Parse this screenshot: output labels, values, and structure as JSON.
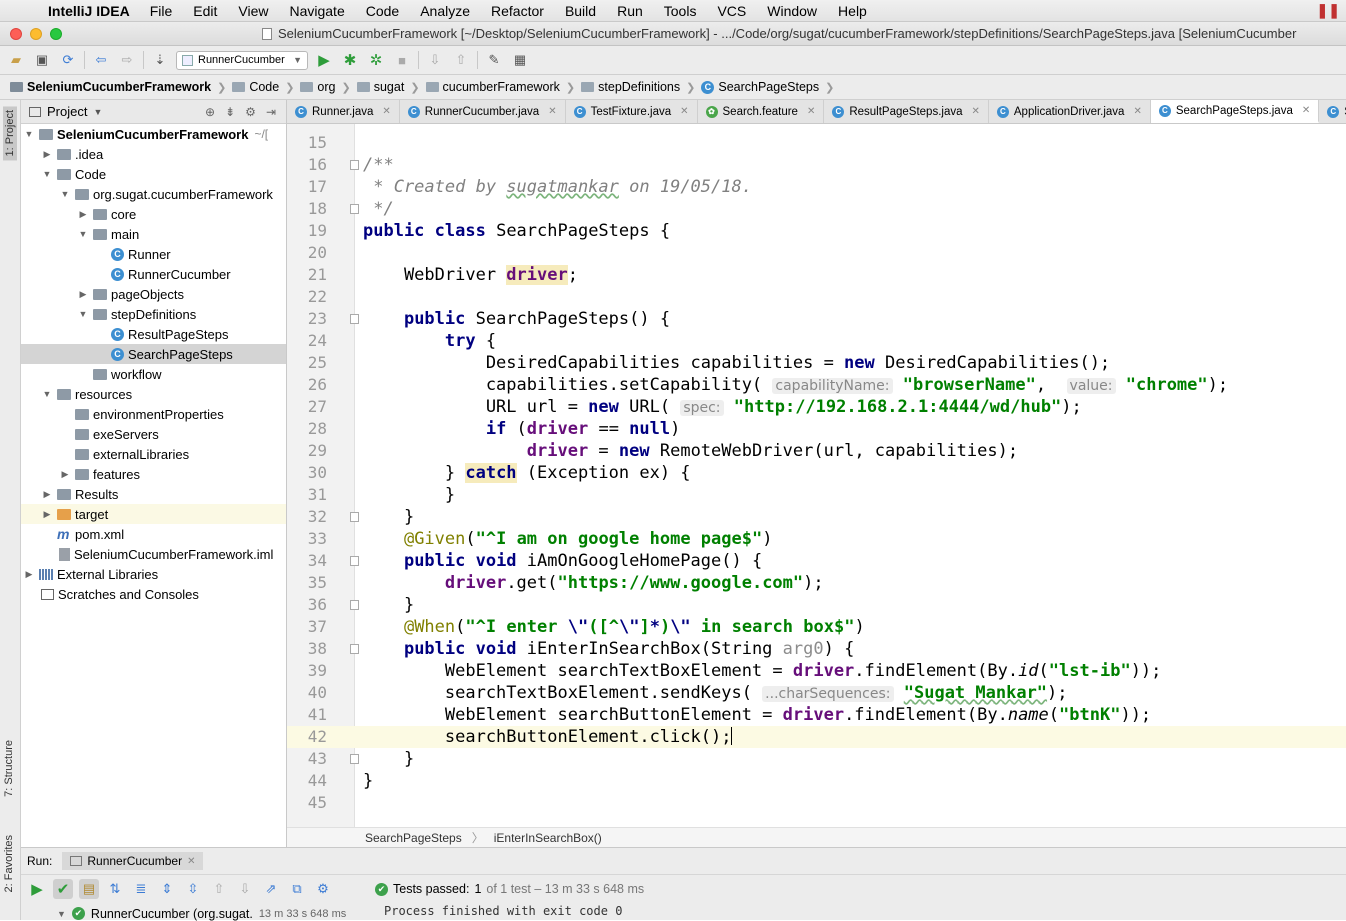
{
  "menubar": {
    "app": "IntelliJ IDEA",
    "items": [
      "File",
      "Edit",
      "View",
      "Navigate",
      "Code",
      "Analyze",
      "Refactor",
      "Build",
      "Run",
      "Tools",
      "VCS",
      "Window",
      "Help"
    ]
  },
  "window": {
    "title": "SeleniumCucumberFramework [~/Desktop/SeleniumCucumberFramework] - .../Code/org/sugat/cucumberFramework/stepDefinitions/SearchPageSteps.java [SeleniumCucumber"
  },
  "toolbar": {
    "run_config": "RunnerCucumber"
  },
  "breadcrumb": [
    "SeleniumCucumberFramework",
    "Code",
    "org",
    "sugat",
    "cucumberFramework",
    "stepDefinitions",
    "SearchPageSteps"
  ],
  "side_tabs": {
    "project": "1: Project",
    "structure": "7: Structure",
    "favorites": "2: Favorites"
  },
  "project_panel": {
    "title": "Project",
    "root_suffix": "~/[",
    "tree": [
      {
        "label": "SeleniumCucumberFramework",
        "bold": true
      },
      {
        "label": ".idea"
      },
      {
        "label": "Code"
      },
      {
        "label": "org.sugat.cucumberFramework"
      },
      {
        "label": "core"
      },
      {
        "label": "main"
      },
      {
        "label": "Runner"
      },
      {
        "label": "RunnerCucumber"
      },
      {
        "label": "pageObjects"
      },
      {
        "label": "stepDefinitions"
      },
      {
        "label": "ResultPageSteps"
      },
      {
        "label": "SearchPageSteps"
      },
      {
        "label": "workflow"
      },
      {
        "label": "resources"
      },
      {
        "label": "environmentProperties"
      },
      {
        "label": "exeServers"
      },
      {
        "label": "externalLibraries"
      },
      {
        "label": "features"
      },
      {
        "label": "Results"
      },
      {
        "label": "target"
      },
      {
        "label": "pom.xml"
      },
      {
        "label": "SeleniumCucumberFramework.iml"
      },
      {
        "label": "External Libraries"
      },
      {
        "label": "Scratches and Consoles"
      }
    ]
  },
  "tabs": [
    "Runner.java",
    "RunnerCucumber.java",
    "TestFixture.java",
    "Search.feature",
    "ResultPageSteps.java",
    "ApplicationDriver.java",
    "SearchPageSteps.java",
    "Se"
  ],
  "active_tab": "SearchPageSteps.java",
  "editor": {
    "line_numbers": [
      "15",
      "16",
      "17",
      "18",
      "19",
      "20",
      "21",
      "22",
      "23",
      "24",
      "25",
      "26",
      "27",
      "28",
      "29",
      "30",
      "31",
      "32",
      "33",
      "34",
      "35",
      "36",
      "37",
      "38",
      "39",
      "40",
      "41",
      "42",
      "43",
      "44",
      "45"
    ],
    "current_line": "42",
    "comment_author": "sugatmankar",
    "comment_date": "19/05/18.",
    "class_name": "SearchPageSteps",
    "hint_capability_name": "capabilityName:",
    "hint_value": "value:",
    "hint_spec": "spec:",
    "hint_char_sequences": "...charSequences:",
    "str_browser_name": "\"browserName\"",
    "str_chrome": "\"chrome\"",
    "str_hub_url": "\"http://192.168.2.1:4444/wd/hub\"",
    "str_google_home": "\"^I am on google home page$\"",
    "str_google_url": "\"https://www.google.com\"",
    "str_lst_ib": "\"lst-ib\"",
    "str_sugat": "\"Sugat Mankar\"",
    "str_btnk": "\"btnK\""
  },
  "editor_breadcrumb": [
    "SearchPageSteps",
    "iEnterInSearchBox()"
  ],
  "run_panel": {
    "label": "Run:",
    "tab": "RunnerCucumber",
    "status_prefix": "Tests passed:",
    "status_count": "1",
    "status_rest": "of 1 test – 13 m 33 s 648 ms",
    "row_label": "RunnerCucumber (org.sugat.",
    "row_time": "13 m 33 s 648 ms",
    "console": "Process finished with exit code 0"
  }
}
